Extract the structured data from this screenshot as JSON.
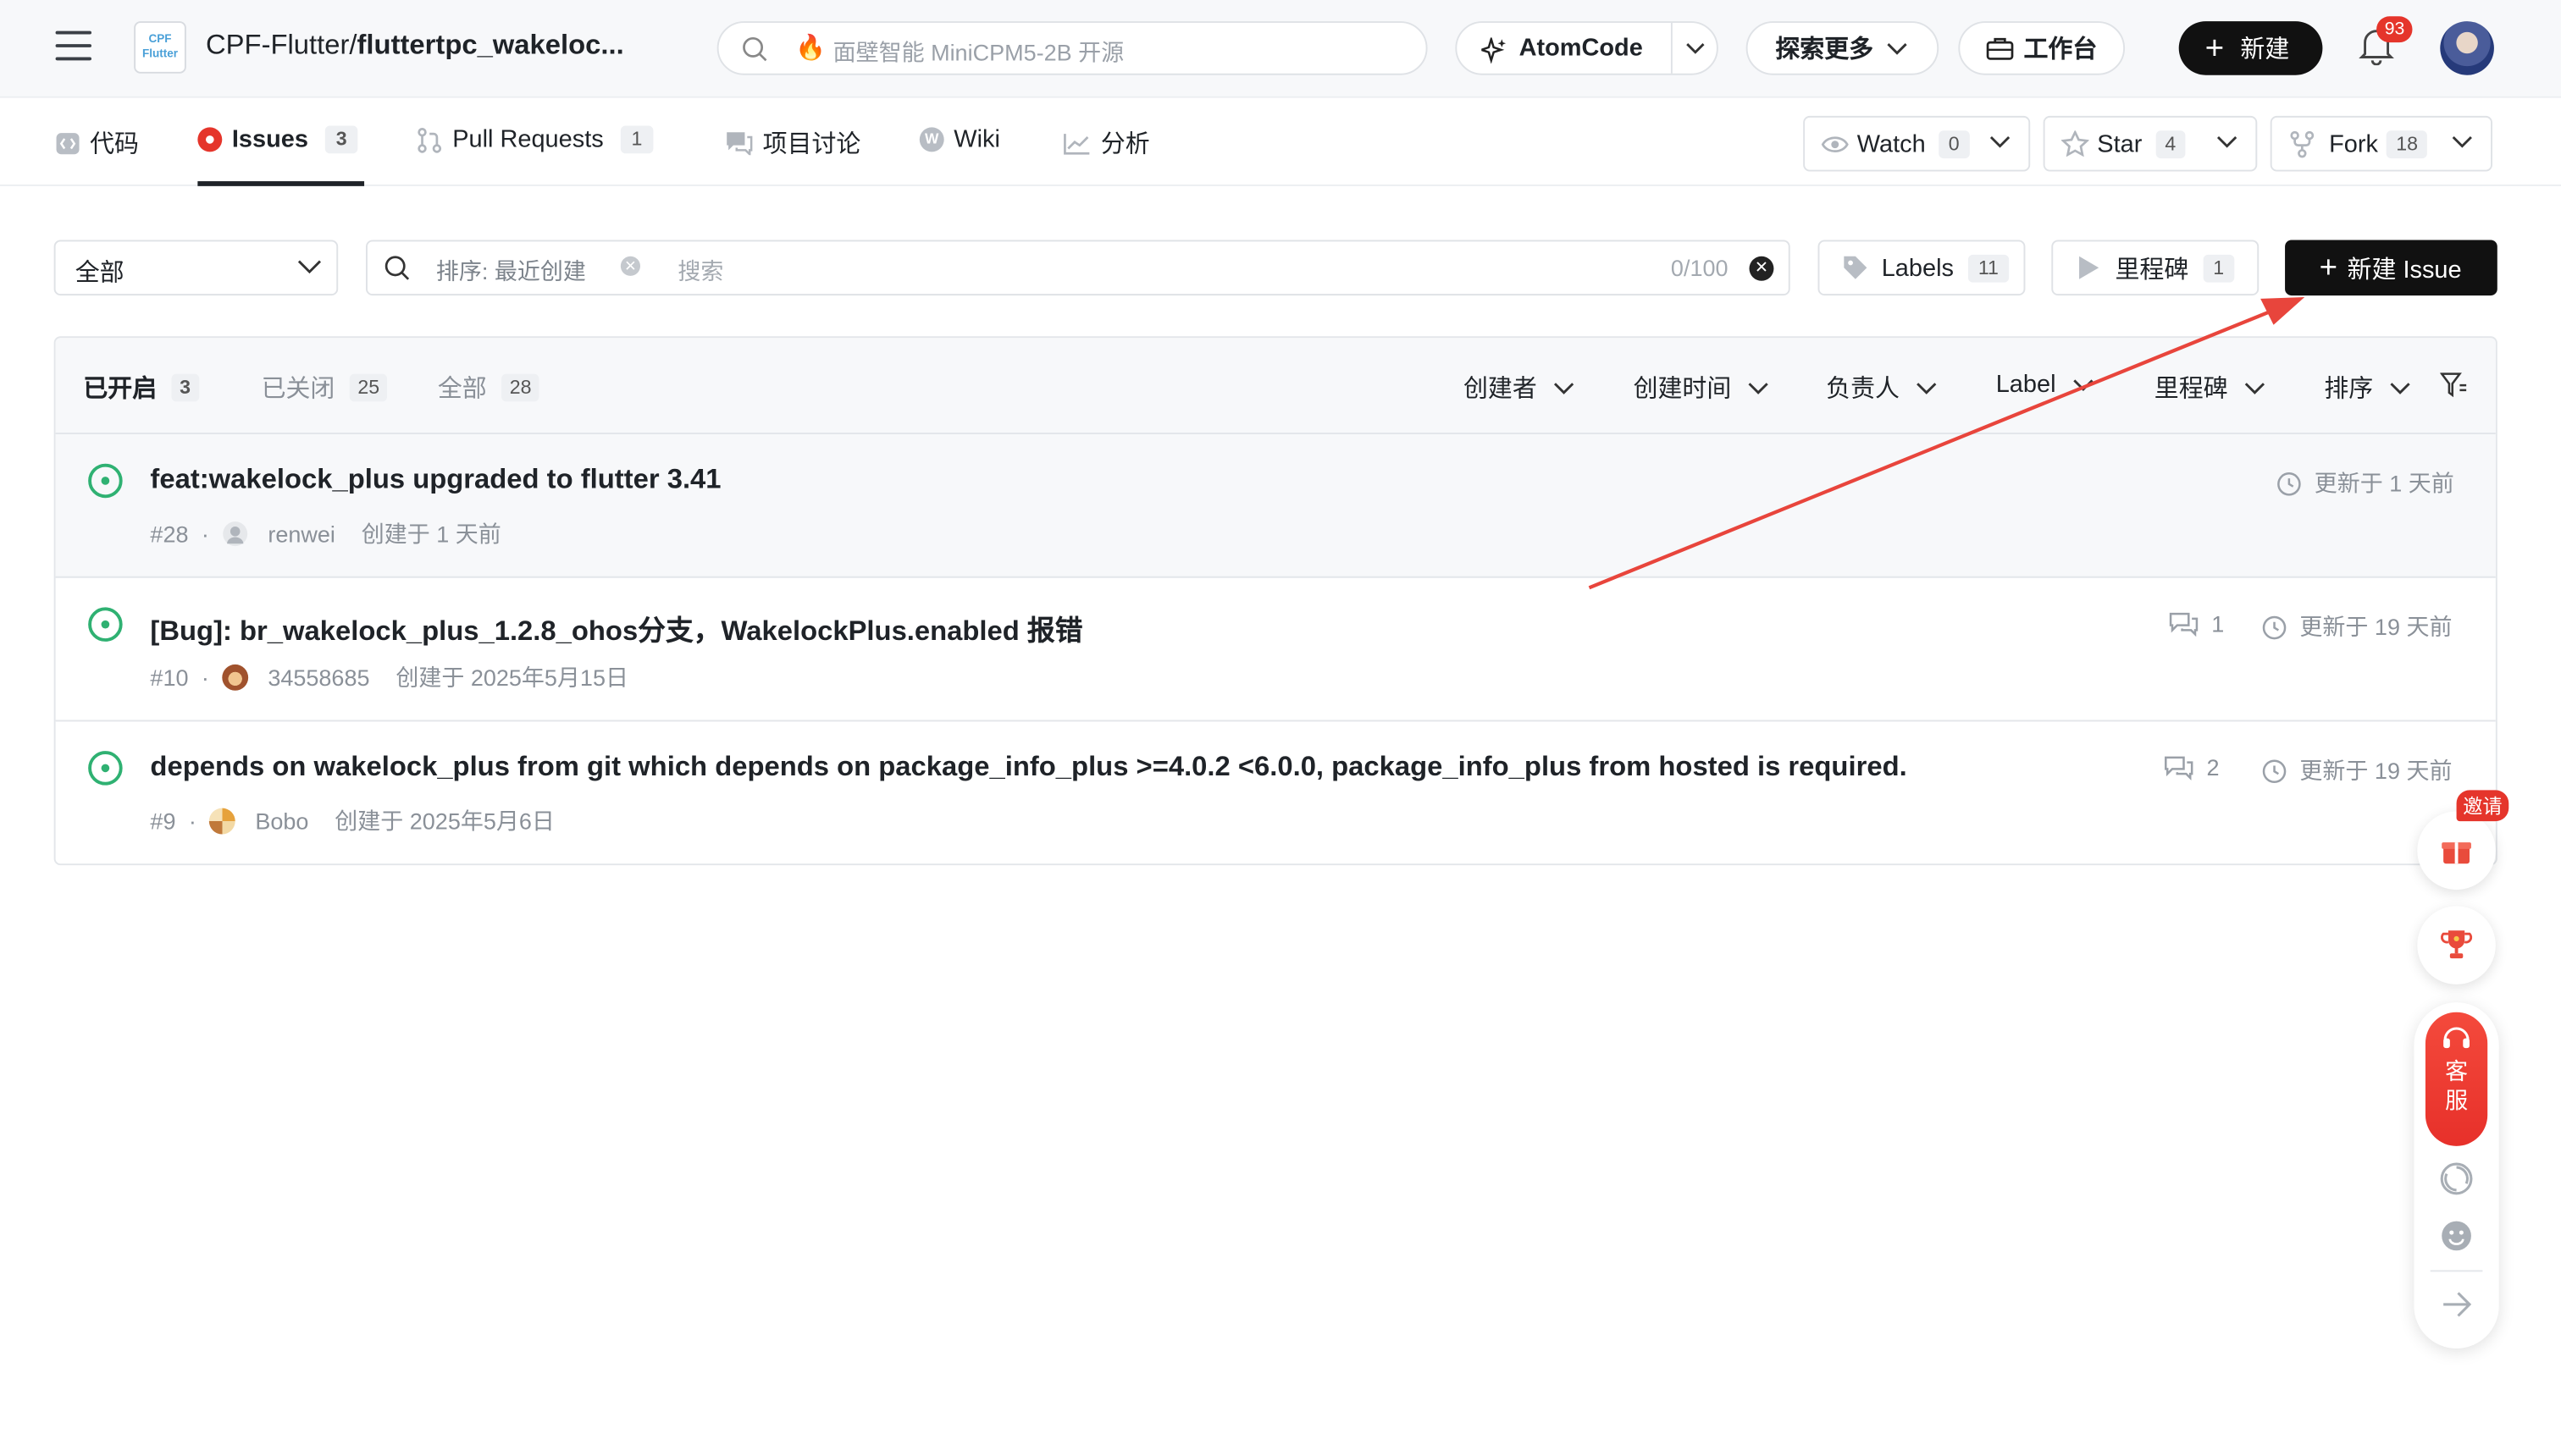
{
  "header": {
    "repo_logo_line1": "CPF",
    "repo_logo_line2": "Flutter",
    "repo_owner": "CPF-Flutter/",
    "repo_name": "fluttertpc_wakeloc...",
    "search_placeholder": "面壁智能 MiniCPM5-2B 开源",
    "atomcode_label": "AtomCode",
    "explore_label": "探索更多",
    "workspace_label": "工作台",
    "new_label": "新建",
    "notification_count": "93"
  },
  "repo_nav": {
    "tabs": [
      {
        "label": "代码",
        "icon": "code-icon"
      },
      {
        "label": "Issues",
        "count": "3",
        "icon": "issue-dot-icon",
        "active": true
      },
      {
        "label": "Pull Requests",
        "count": "1",
        "icon": "pull-request-icon"
      },
      {
        "label": "项目讨论",
        "icon": "discussion-icon"
      },
      {
        "label": "Wiki",
        "icon": "wiki-icon"
      },
      {
        "label": "分析",
        "icon": "chart-icon"
      }
    ],
    "watch": {
      "label": "Watch",
      "count": "0"
    },
    "star": {
      "label": "Star",
      "count": "4"
    },
    "fork": {
      "label": "Fork",
      "count": "18"
    }
  },
  "toolbar": {
    "state_select": "全部",
    "sort_label": "排序: 最近创建",
    "search_placeholder": "搜索",
    "char_counter": "0/100",
    "labels": {
      "label": "Labels",
      "count": "11"
    },
    "milestones": {
      "label": "里程碑",
      "count": "1"
    },
    "new_issue": "新建 Issue"
  },
  "list": {
    "state_tabs": [
      {
        "label": "已开启",
        "count": "3",
        "active": true
      },
      {
        "label": "已关闭",
        "count": "25"
      },
      {
        "label": "全部",
        "count": "28"
      }
    ],
    "filters": [
      "创建者",
      "创建时间",
      "负责人",
      "Label",
      "里程碑",
      "排序"
    ],
    "issues": [
      {
        "title": "feat:wakelock_plus upgraded to flutter 3.41",
        "number": "#28",
        "author": "renwei",
        "created": "创建于 1 天前",
        "comments": "",
        "updated": "更新于 1 天前",
        "highlighted": true
      },
      {
        "title": "[Bug]: br_wakelock_plus_1.2.8_ohos分支，WakelockPlus.enabled 报错",
        "number": "#10",
        "author": "34558685",
        "created": "创建于 2025年5月15日",
        "comments": "1",
        "updated": "更新于 19 天前",
        "highlighted": false
      },
      {
        "title": "depends on wakelock_plus from git which depends on package_info_plus >=4.0.2 <6.0.0, package_info_plus from hosted is required.",
        "number": "#9",
        "author": "Bobo",
        "created": "创建于 2025年5月6日",
        "comments": "2",
        "updated": "更新于 19 天前",
        "highlighted": false
      }
    ]
  },
  "floating": {
    "invite_label": "邀请",
    "customer_service_line1": "客",
    "customer_service_line2": "服"
  },
  "colors": {
    "open_green": "#2fb172",
    "annotation_red": "#e8453c",
    "badge_red": "#e5352b"
  }
}
